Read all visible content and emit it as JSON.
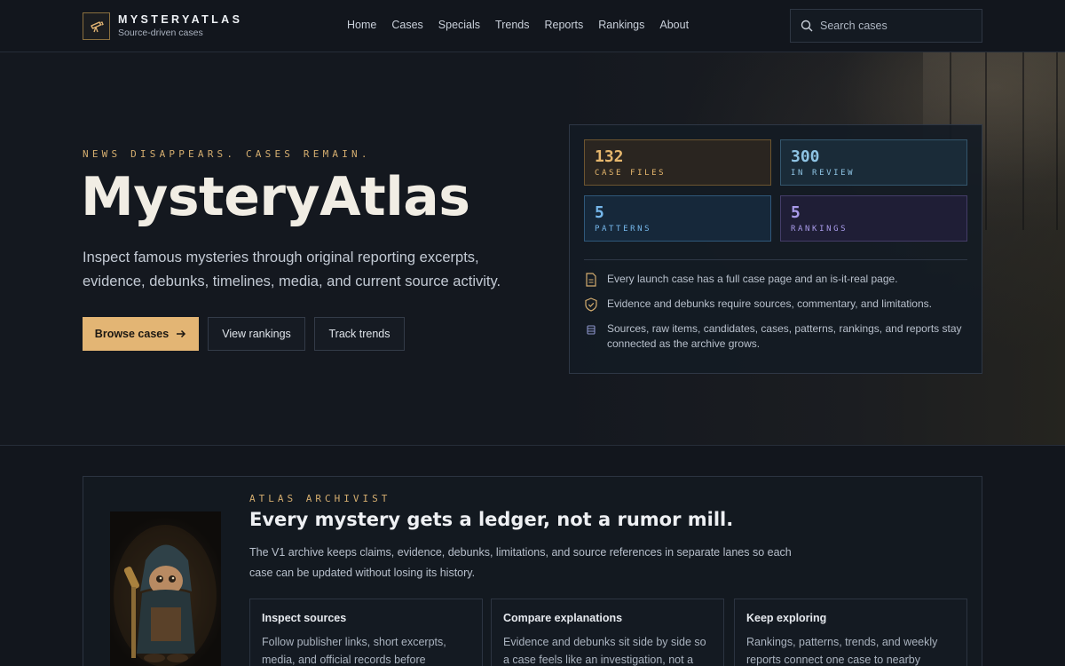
{
  "header": {
    "brand_name": "MYSTERYATLAS",
    "brand_sub": "Source-driven cases",
    "logo_icon": "telescope-icon",
    "nav": [
      "Home",
      "Cases",
      "Specials",
      "Trends",
      "Reports",
      "Rankings",
      "About"
    ],
    "search_placeholder": "Search cases"
  },
  "hero": {
    "kicker": "NEWS DISAPPEARS. CASES REMAIN.",
    "title": "MysteryAtlas",
    "description": "Inspect famous mysteries through original reporting excerpts, evidence, debunks, timelines, media, and current source activity.",
    "buttons": {
      "browse": "Browse cases",
      "rankings": "View rankings",
      "trends": "Track trends"
    }
  },
  "stats": [
    {
      "value": "132",
      "label": "CASE FILES",
      "color": "#e6b76d"
    },
    {
      "value": "300",
      "label": "IN REVIEW",
      "color": "#8ec3e3"
    },
    {
      "value": "5",
      "label": "PATTERNS",
      "color": "#76b8ec"
    },
    {
      "value": "5",
      "label": "RANKINGS",
      "color": "#a99bea"
    }
  ],
  "features": [
    {
      "icon": "document-icon",
      "text": "Every launch case has a full case page and an is-it-real page."
    },
    {
      "icon": "shield-check-icon",
      "text": "Evidence and debunks require sources, commentary, and limitations."
    },
    {
      "icon": "database-icon",
      "text": "Sources, raw items, candidates, cases, patterns, rankings, and reports stay connected as the archive grows."
    }
  ],
  "archivist": {
    "kicker": "ATLAS ARCHIVIST",
    "title": "Every mystery gets a ledger, not a rumor mill.",
    "description": "The V1 archive keeps claims, evidence, debunks, limitations, and source references in separate lanes so each case can be updated without losing its history.",
    "cards": [
      {
        "title": "Inspect sources",
        "text": "Follow publisher links, short excerpts, media, and official records before accepting"
      },
      {
        "title": "Compare explanations",
        "text": "Evidence and debunks sit side by side so a case feels like an investigation, not a single"
      },
      {
        "title": "Keep exploring",
        "text": "Rankings, patterns, trends, and weekly reports connect one case to nearby"
      }
    ]
  },
  "colors": {
    "accent": "#e3b574",
    "background": "#12161d"
  }
}
